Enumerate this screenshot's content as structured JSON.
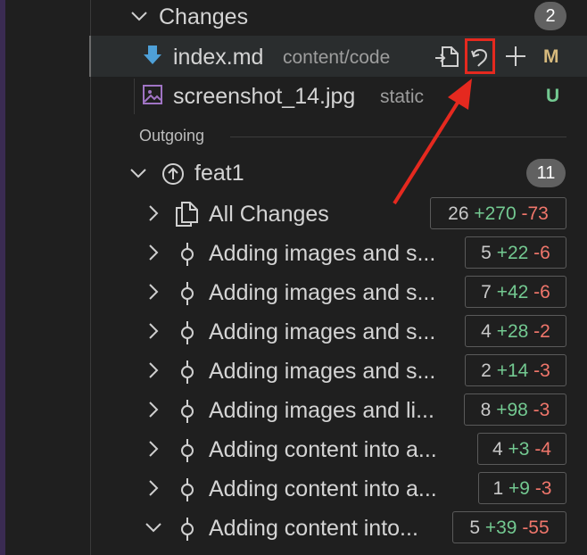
{
  "changes_section": {
    "label": "Changes",
    "count": "2"
  },
  "changed_files": [
    {
      "name": "index.md",
      "path": "content/code",
      "status": "M",
      "status_color": "#d7ba7d",
      "icon": "markdown-download-icon"
    },
    {
      "name": "screenshot_14.jpg",
      "path": "static",
      "status": "U",
      "status_color": "#73c991",
      "icon": "image-file-icon"
    }
  ],
  "outgoing_label": "Outgoing",
  "branch": {
    "name": "feat1",
    "count": "11"
  },
  "all_changes": {
    "label": "All Changes",
    "files": "26",
    "added": "+270",
    "deleted": "-73"
  },
  "commits": [
    {
      "label": "Adding images and s...",
      "files": "5",
      "added": "+22",
      "deleted": "-6"
    },
    {
      "label": "Adding images and s...",
      "files": "7",
      "added": "+42",
      "deleted": "-6"
    },
    {
      "label": "Adding images and s...",
      "files": "4",
      "added": "+28",
      "deleted": "-2"
    },
    {
      "label": "Adding images and s...",
      "files": "2",
      "added": "+14",
      "deleted": "-3"
    },
    {
      "label": "Adding images and li...",
      "files": "8",
      "added": "+98",
      "deleted": "-3"
    },
    {
      "label": "Adding content into a...",
      "files": "4",
      "added": "+3",
      "deleted": "-4"
    },
    {
      "label": "Adding content into a...",
      "files": "1",
      "added": "+9",
      "deleted": "-3"
    },
    {
      "label": "Adding content into...",
      "files": "5",
      "added": "+39",
      "deleted": "-55"
    }
  ],
  "colors": {
    "highlight": "#e5291f",
    "added": "#73c991",
    "deleted": "#f0766b"
  }
}
